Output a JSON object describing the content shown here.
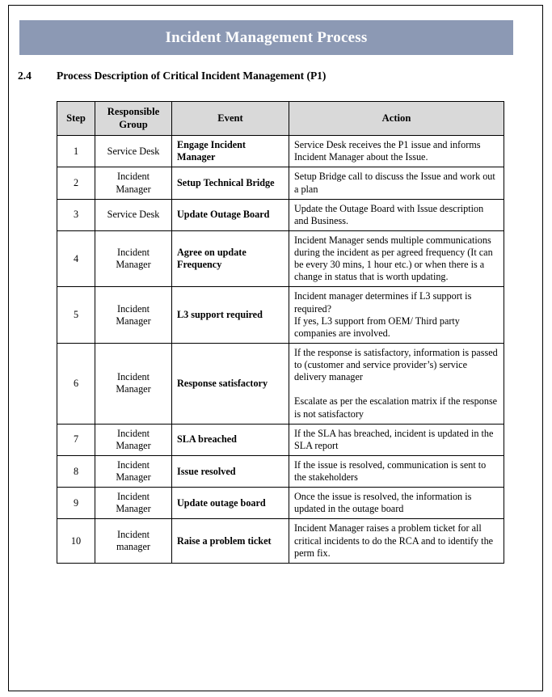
{
  "banner": {
    "title": "Incident Management Process"
  },
  "heading": {
    "number": "2.4",
    "text": "Process Description of Critical Incident Management (P1)"
  },
  "colors": {
    "banner_background": "#8c99b4",
    "banner_text": "#ffffff",
    "table_header_background": "#d9d9d9",
    "table_border": "#000000",
    "page_background": "#ffffff",
    "body_text": "#000000"
  },
  "table": {
    "columns": [
      "Step",
      "Responsible\nGroup",
      "Event",
      "Action"
    ],
    "headers": {
      "step": "Step",
      "group": "Responsible Group",
      "event": "Event",
      "action": "Action"
    },
    "rows": [
      {
        "step": "1",
        "group": "Service Desk",
        "event": "Engage Incident Manager",
        "action": "Service Desk receives the P1 issue and informs Incident Manager about the Issue."
      },
      {
        "step": "2",
        "group": "Incident Manager",
        "event": "Setup Technical Bridge",
        "action": "Setup Bridge call to discuss the Issue and work out a plan"
      },
      {
        "step": "3",
        "group": "Service Desk",
        "event": "Update Outage Board",
        "action": "Update the Outage Board with Issue description and Business."
      },
      {
        "step": "4",
        "group": "Incident Manager",
        "event": "Agree on update Frequency",
        "action": "Incident Manager sends multiple communications during the incident as per agreed frequency (It can be every 30 mins, 1 hour etc.) or when there is a change in status that is worth updating."
      },
      {
        "step": "5",
        "group": "Incident Manager",
        "event": "L3 support required",
        "action": "Incident manager determines if L3 support is required?\nIf yes, L3 support from OEM/ Third party companies are involved."
      },
      {
        "step": "6",
        "group": "Incident Manager",
        "event": "Response satisfactory",
        "action": "If the response is satisfactory, information is passed to (customer and service provider’s) service delivery manager\n\nEscalate as per the escalation matrix if the response is not satisfactory"
      },
      {
        "step": "7",
        "group": "Incident Manager",
        "event": "SLA breached",
        "action": "If the SLA has breached, incident is updated in the SLA report"
      },
      {
        "step": "8",
        "group": "Incident Manager",
        "event": "Issue resolved",
        "action": "If the issue is resolved, communication is sent to the stakeholders"
      },
      {
        "step": "9",
        "group": "Incident Manager",
        "event": "Update outage board",
        "action": "Once the issue is resolved, the information is updated in the outage board"
      },
      {
        "step": "10",
        "group": "Incident manager",
        "event": "Raise a problem ticket",
        "action": "Incident Manager raises a problem ticket for all critical incidents to do the RCA and to identify the perm fix."
      }
    ]
  }
}
